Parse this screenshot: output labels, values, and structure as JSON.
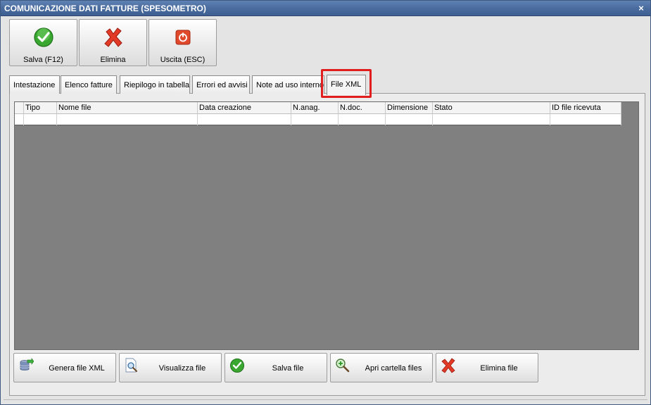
{
  "window": {
    "title": "COMUNICAZIONE DATI FATTURE (SPESOMETRO)",
    "close_glyph": "×"
  },
  "toolbar": {
    "buttons": [
      {
        "label": "Salva (F12)",
        "icon": "check-icon"
      },
      {
        "label": "Elimina",
        "icon": "delete-x-icon"
      },
      {
        "label": "Uscita (ESC)",
        "icon": "power-icon"
      }
    ]
  },
  "tabs": [
    {
      "label": "Intestazione"
    },
    {
      "label": "Elenco fatture"
    },
    {
      "label": "Riepilogo in tabella"
    },
    {
      "label": "Errori ed avvisi"
    },
    {
      "label": "Note ad uso interno"
    },
    {
      "label": "File XML",
      "active": true
    }
  ],
  "grid": {
    "columns": [
      "Tipo",
      "Nome file",
      "Data creazione",
      "N.anag.",
      "N.doc.",
      "Dimensione",
      "Stato",
      "ID file ricevuta"
    ]
  },
  "actions": [
    {
      "label": "Genera file XML",
      "icon": "database-export-icon"
    },
    {
      "label": "Visualizza file",
      "icon": "magnifier-document-icon"
    },
    {
      "label": "Salva file",
      "icon": "check-icon"
    },
    {
      "label": "Apri cartella files",
      "icon": "zoom-in-icon"
    },
    {
      "label": "Elimina file",
      "icon": "delete-x-icon"
    }
  ],
  "colors": {
    "titlebar": "#4a6c9e",
    "highlight": "#e01e1e",
    "grid_background": "#808080"
  }
}
